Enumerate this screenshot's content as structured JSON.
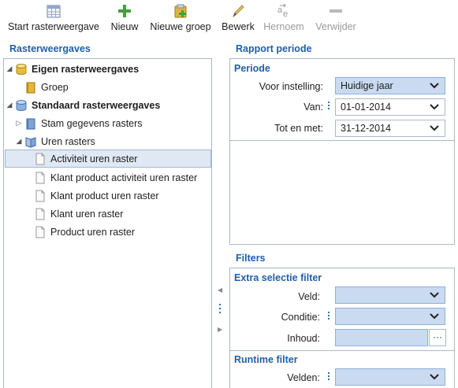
{
  "toolbar": {
    "items": [
      {
        "label": "Start rasterweergave",
        "icon": "grid-table-icon",
        "enabled": true
      },
      {
        "label": "Nieuw",
        "icon": "plus-icon",
        "enabled": true
      },
      {
        "label": "Nieuwe groep",
        "icon": "add-group-icon",
        "enabled": true
      },
      {
        "label": "Bewerk",
        "icon": "pencil-icon",
        "enabled": true
      },
      {
        "label": "Hernoem",
        "icon": "rename-icon",
        "enabled": false
      },
      {
        "label": "Verwijder",
        "icon": "minus-icon",
        "enabled": false
      }
    ]
  },
  "left": {
    "title": "Rasterweergaves",
    "tree": [
      {
        "label": "Eigen rasterweergaves",
        "bold": true,
        "icon": "database-icon",
        "arrow": "expanded"
      },
      {
        "label": "Groep",
        "bold": false,
        "icon": "folder-book-icon",
        "arrow": "none"
      },
      {
        "label": "Standaard rasterweergaves",
        "bold": true,
        "icon": "database-blue-icon",
        "arrow": "expanded"
      },
      {
        "label": "Stam gegevens rasters",
        "bold": false,
        "icon": "blue-book-icon",
        "arrow": "collapsed"
      },
      {
        "label": "Uren rasters",
        "bold": false,
        "icon": "open-book-icon",
        "arrow": "expanded"
      },
      {
        "label": "Activiteit uren raster",
        "bold": false,
        "icon": "document-icon",
        "arrow": "none",
        "selected": true
      },
      {
        "label": "Klant product activiteit uren raster",
        "bold": false,
        "icon": "document-icon",
        "arrow": "none"
      },
      {
        "label": "Klant product uren raster",
        "bold": false,
        "icon": "document-icon",
        "arrow": "none"
      },
      {
        "label": "Klant uren raster",
        "bold": false,
        "icon": "document-icon",
        "arrow": "none"
      },
      {
        "label": "Product uren raster",
        "bold": false,
        "icon": "document-icon",
        "arrow": "none"
      }
    ]
  },
  "report": {
    "title": "Rapport periode",
    "group_title": "Periode",
    "preset_label": "Voor instelling:",
    "preset_value": "Huidige jaar",
    "from_label": "Van:",
    "from_value": "01-01-2014",
    "to_label": "Tot en met:",
    "to_value": "31-12-2014"
  },
  "filters": {
    "title": "Filters",
    "extra_title": "Extra selectie filter",
    "field_label": "Veld:",
    "condition_label": "Conditie:",
    "content_label": "Inhoud:",
    "ellipsis": "···",
    "runtime_title": "Runtime filter",
    "fields_label": "Velden:"
  },
  "colors": {
    "accent": "#1f5fa8",
    "selection": "#dfe8f3",
    "field_blue": "#c9daf1",
    "border": "#a9b8c8"
  }
}
